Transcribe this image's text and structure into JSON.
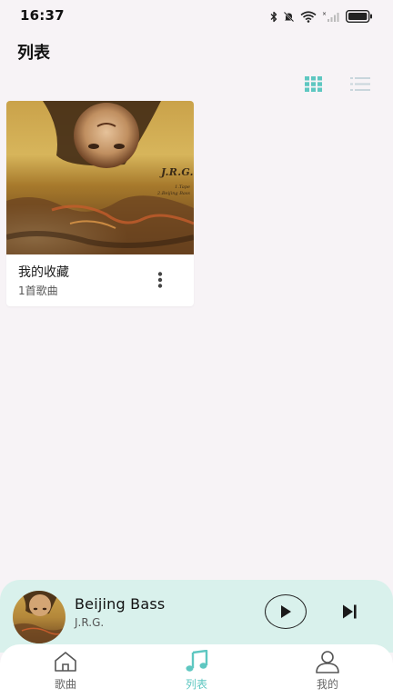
{
  "status_bar": {
    "time": "16:37",
    "icons": [
      "bluetooth-icon",
      "mute-icon",
      "wifi-icon",
      "signal-icon",
      "battery-icon"
    ]
  },
  "header": {
    "title": "列表"
  },
  "view_toggle": {
    "active": "grid",
    "accent_color": "#5ec7c1",
    "inactive_color": "#c9d6dc"
  },
  "playlists": [
    {
      "title": "我的收藏",
      "subtitle": "1首歌曲",
      "cover_artist": "J.R.G.",
      "cover_tracks": [
        "1.Tape",
        "2.Beijing Bass"
      ]
    }
  ],
  "mini_player": {
    "song": "Beijing Bass",
    "artist": "J.R.G.",
    "background": "#d9f1ec"
  },
  "tabs": [
    {
      "label": "歌曲",
      "icon": "home-icon",
      "active": false
    },
    {
      "label": "列表",
      "icon": "music-note-icon",
      "active": true
    },
    {
      "label": "我的",
      "icon": "user-icon",
      "active": false
    }
  ]
}
